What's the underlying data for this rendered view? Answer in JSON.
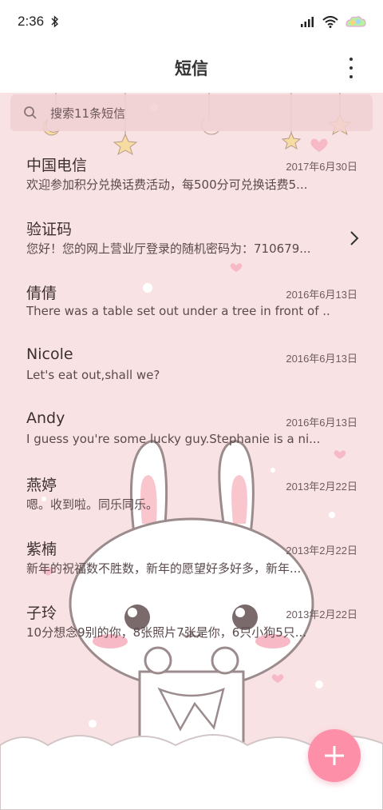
{
  "status_bar": {
    "time": "2:36"
  },
  "app_bar": {
    "title": "短信"
  },
  "search": {
    "placeholder": "搜索11条短信"
  },
  "messages": [
    {
      "name": "中国电信",
      "date": "2017年6月30日",
      "preview": "欢迎参加积分兑换话费活动，每500分可兑换话费5..."
    },
    {
      "name": "验证码",
      "date": "",
      "preview": "您好！您的网上营业厅登录的随机密码为：710679..."
    },
    {
      "name": "倩倩",
      "date": "2016年6月13日",
      "preview": "There was a table set out under a tree in front of ..."
    },
    {
      "name": "Nicole",
      "date": "2016年6月13日",
      "preview": "Let's eat out,shall we?"
    },
    {
      "name": "Andy",
      "date": "2016年6月13日",
      "preview": "I guess you're some lucky guy.Stephanie is a ni..."
    },
    {
      "name": "燕婷",
      "date": "2013年2月22日",
      "preview": "嗯。收到啦。同乐同乐。"
    },
    {
      "name": "紫楠",
      "date": "2013年2月22日",
      "preview": "新年的祝福数不胜数，新年的愿望好多好多，新年..."
    },
    {
      "name": "子玲",
      "date": "2013年2月22日",
      "preview": "10分想念9别的你，8张照片7张是你，6只小狗5只..."
    }
  ],
  "icons": {
    "bluetooth": "bluetooth-icon",
    "signal": "signal-icon",
    "wifi": "wifi-icon",
    "battery": "battery-icon",
    "more": "more-vert-icon",
    "search": "search-icon",
    "chevron": "chevron-right-icon",
    "add": "plus-icon"
  },
  "colors": {
    "background": "#f9e2e3",
    "fab": "#fd8fa8",
    "bar": "#ffffff"
  }
}
